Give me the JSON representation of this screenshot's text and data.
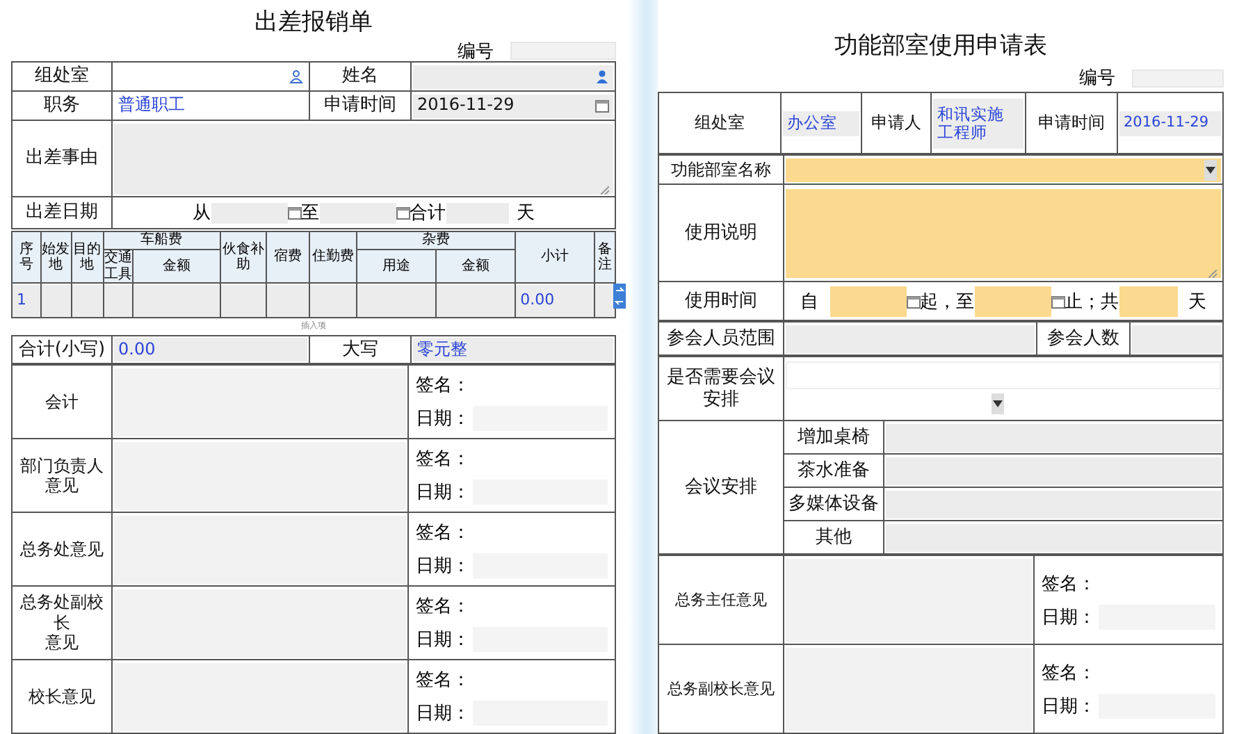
{
  "travel_form": {
    "title": "出差报销单",
    "number_label": "编号",
    "info": [
      {
        "label": "组处室",
        "field": {
          "readonly": false
        }
      },
      {
        "label": "姓名",
        "field": {
          "readonly": true
        }
      },
      {
        "label": "职务",
        "field": {
          "readonly": false,
          "value": "普通职工",
          "auto_filled": true
        }
      },
      {
        "label": "申请时间",
        "field": {
          "readonly": true,
          "value": "2016-11-29",
          "auto_filled": false
        }
      }
    ],
    "reason": {
      "label": "出差事由"
    },
    "dates": {
      "label": "出差日期",
      "from": "从",
      "to": "至",
      "total": "合计",
      "unit": "天"
    },
    "expenses": {
      "columns": [
        {
          "label": "序号",
          "value": "1"
        },
        {
          "label": "始发地"
        },
        {
          "label": "目的地"
        },
        {
          "label": "车船费",
          "children": [
            {
              "label": "交通工具"
            },
            {
              "label": "金额"
            }
          ]
        },
        {
          "label": "伙食补助"
        },
        {
          "label": "宿费"
        },
        {
          "label": "住勤费"
        },
        {
          "label": "杂费",
          "children": [
            {
              "label": "用途"
            },
            {
              "label": "金额"
            }
          ]
        },
        {
          "label": "小计",
          "value": "0.00"
        },
        {
          "label": "备注"
        }
      ],
      "insert_label": "插入项"
    },
    "totals": [
      {
        "label": "合计(小写)",
        "value": "0.00"
      },
      {
        "label": "大写",
        "value": "零元整"
      }
    ],
    "approvals": [
      {
        "lines": [
          "会计"
        ],
        "sign_label": "签名：",
        "date_label": "日期："
      },
      {
        "lines": [
          "部门负责人",
          "意见"
        ],
        "sign_label": "签名：",
        "date_label": "日期："
      },
      {
        "lines": [
          "总务处意见"
        ],
        "sign_label": "签名：",
        "date_label": "日期："
      },
      {
        "lines": [
          "总务处副校",
          "长",
          "意见"
        ],
        "sign_label": "签名：",
        "date_label": "日期："
      },
      {
        "lines": [
          "校长意见"
        ],
        "sign_label": "签名：",
        "date_label": "日期："
      }
    ]
  },
  "room_form": {
    "title": "功能部室使用申请表",
    "number_label": "编号",
    "applicant": [
      {
        "label": "组处室",
        "value": "办公室"
      },
      {
        "label": "申请人",
        "value": "和讯实施工程师"
      },
      {
        "label": "申请时间",
        "value": "2016-11-29"
      }
    ],
    "room": {
      "label": "功能部室名称",
      "required": true
    },
    "description": {
      "label": "使用说明",
      "required": true
    },
    "time": {
      "label": "使用时间",
      "required": true,
      "parts": [
        "自",
        "起，至",
        "止；共",
        "天"
      ]
    },
    "attendees": [
      {
        "label": "参会人员范围"
      },
      {
        "label": "参会人数"
      }
    ],
    "meeting_needed": {
      "label": "是否需要会议安排"
    },
    "arrangements": {
      "label": "会议安排",
      "items": [
        "增加桌椅",
        "茶水准备",
        "多媒体设备",
        "其他"
      ]
    },
    "approvals": [
      {
        "label": "总务主任意见",
        "sign_label": "签名：",
        "date_label": "日期："
      },
      {
        "label": "总务副校长意见",
        "sign_label": "签名：",
        "date_label": "日期："
      }
    ]
  }
}
